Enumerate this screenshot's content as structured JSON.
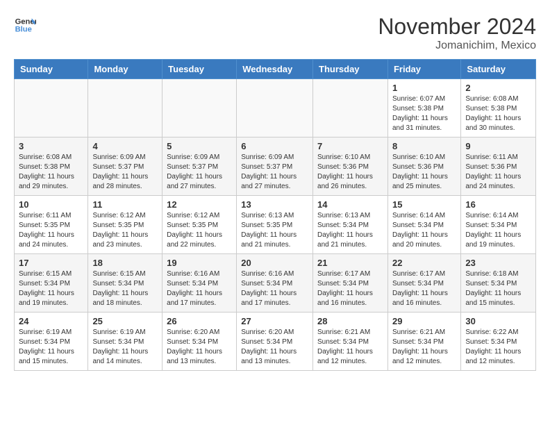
{
  "header": {
    "logo_line1": "General",
    "logo_line2": "Blue",
    "month": "November 2024",
    "location": "Jomanichim, Mexico"
  },
  "days_of_week": [
    "Sunday",
    "Monday",
    "Tuesday",
    "Wednesday",
    "Thursday",
    "Friday",
    "Saturday"
  ],
  "weeks": [
    [
      {
        "day": "",
        "info": ""
      },
      {
        "day": "",
        "info": ""
      },
      {
        "day": "",
        "info": ""
      },
      {
        "day": "",
        "info": ""
      },
      {
        "day": "",
        "info": ""
      },
      {
        "day": "1",
        "info": "Sunrise: 6:07 AM\nSunset: 5:38 PM\nDaylight: 11 hours and 31 minutes."
      },
      {
        "day": "2",
        "info": "Sunrise: 6:08 AM\nSunset: 5:38 PM\nDaylight: 11 hours and 30 minutes."
      }
    ],
    [
      {
        "day": "3",
        "info": "Sunrise: 6:08 AM\nSunset: 5:38 PM\nDaylight: 11 hours and 29 minutes."
      },
      {
        "day": "4",
        "info": "Sunrise: 6:09 AM\nSunset: 5:37 PM\nDaylight: 11 hours and 28 minutes."
      },
      {
        "day": "5",
        "info": "Sunrise: 6:09 AM\nSunset: 5:37 PM\nDaylight: 11 hours and 27 minutes."
      },
      {
        "day": "6",
        "info": "Sunrise: 6:09 AM\nSunset: 5:37 PM\nDaylight: 11 hours and 27 minutes."
      },
      {
        "day": "7",
        "info": "Sunrise: 6:10 AM\nSunset: 5:36 PM\nDaylight: 11 hours and 26 minutes."
      },
      {
        "day": "8",
        "info": "Sunrise: 6:10 AM\nSunset: 5:36 PM\nDaylight: 11 hours and 25 minutes."
      },
      {
        "day": "9",
        "info": "Sunrise: 6:11 AM\nSunset: 5:36 PM\nDaylight: 11 hours and 24 minutes."
      }
    ],
    [
      {
        "day": "10",
        "info": "Sunrise: 6:11 AM\nSunset: 5:35 PM\nDaylight: 11 hours and 24 minutes."
      },
      {
        "day": "11",
        "info": "Sunrise: 6:12 AM\nSunset: 5:35 PM\nDaylight: 11 hours and 23 minutes."
      },
      {
        "day": "12",
        "info": "Sunrise: 6:12 AM\nSunset: 5:35 PM\nDaylight: 11 hours and 22 minutes."
      },
      {
        "day": "13",
        "info": "Sunrise: 6:13 AM\nSunset: 5:35 PM\nDaylight: 11 hours and 21 minutes."
      },
      {
        "day": "14",
        "info": "Sunrise: 6:13 AM\nSunset: 5:34 PM\nDaylight: 11 hours and 21 minutes."
      },
      {
        "day": "15",
        "info": "Sunrise: 6:14 AM\nSunset: 5:34 PM\nDaylight: 11 hours and 20 minutes."
      },
      {
        "day": "16",
        "info": "Sunrise: 6:14 AM\nSunset: 5:34 PM\nDaylight: 11 hours and 19 minutes."
      }
    ],
    [
      {
        "day": "17",
        "info": "Sunrise: 6:15 AM\nSunset: 5:34 PM\nDaylight: 11 hours and 19 minutes."
      },
      {
        "day": "18",
        "info": "Sunrise: 6:15 AM\nSunset: 5:34 PM\nDaylight: 11 hours and 18 minutes."
      },
      {
        "day": "19",
        "info": "Sunrise: 6:16 AM\nSunset: 5:34 PM\nDaylight: 11 hours and 17 minutes."
      },
      {
        "day": "20",
        "info": "Sunrise: 6:16 AM\nSunset: 5:34 PM\nDaylight: 11 hours and 17 minutes."
      },
      {
        "day": "21",
        "info": "Sunrise: 6:17 AM\nSunset: 5:34 PM\nDaylight: 11 hours and 16 minutes."
      },
      {
        "day": "22",
        "info": "Sunrise: 6:17 AM\nSunset: 5:34 PM\nDaylight: 11 hours and 16 minutes."
      },
      {
        "day": "23",
        "info": "Sunrise: 6:18 AM\nSunset: 5:34 PM\nDaylight: 11 hours and 15 minutes."
      }
    ],
    [
      {
        "day": "24",
        "info": "Sunrise: 6:19 AM\nSunset: 5:34 PM\nDaylight: 11 hours and 15 minutes."
      },
      {
        "day": "25",
        "info": "Sunrise: 6:19 AM\nSunset: 5:34 PM\nDaylight: 11 hours and 14 minutes."
      },
      {
        "day": "26",
        "info": "Sunrise: 6:20 AM\nSunset: 5:34 PM\nDaylight: 11 hours and 13 minutes."
      },
      {
        "day": "27",
        "info": "Sunrise: 6:20 AM\nSunset: 5:34 PM\nDaylight: 11 hours and 13 minutes."
      },
      {
        "day": "28",
        "info": "Sunrise: 6:21 AM\nSunset: 5:34 PM\nDaylight: 11 hours and 12 minutes."
      },
      {
        "day": "29",
        "info": "Sunrise: 6:21 AM\nSunset: 5:34 PM\nDaylight: 11 hours and 12 minutes."
      },
      {
        "day": "30",
        "info": "Sunrise: 6:22 AM\nSunset: 5:34 PM\nDaylight: 11 hours and 12 minutes."
      }
    ]
  ]
}
